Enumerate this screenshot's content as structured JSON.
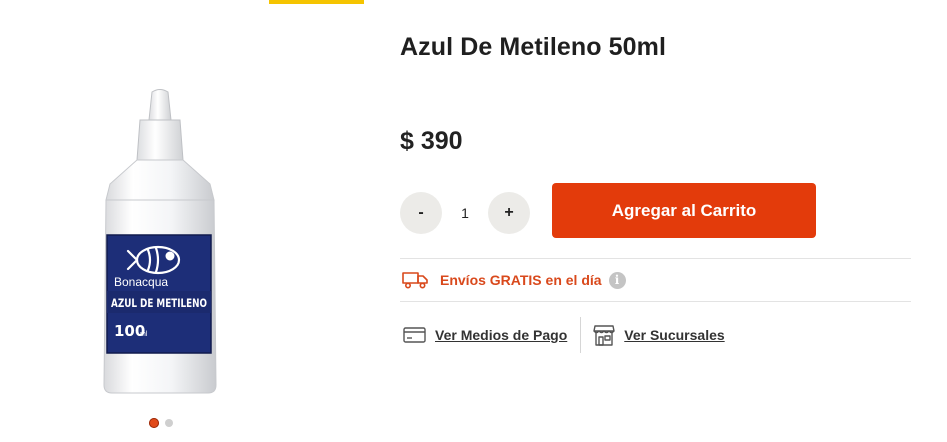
{
  "product": {
    "title": "Azul De Metileno 50ml",
    "price": "$ 390",
    "image_label": {
      "brand": "Bonacqua",
      "name": "AZUL DE METILENO",
      "volume": "100",
      "volume_unit": "ml"
    }
  },
  "gallery": {
    "slide_count": 2,
    "active_slide": 1
  },
  "quantity": {
    "minus_label": "-",
    "value": "1",
    "plus_label": "+"
  },
  "cart": {
    "add_label": "Agregar al Carrito"
  },
  "shipping": {
    "icon": "truck-icon",
    "text": "Envíos GRATIS en el día",
    "info_icon": "info-icon",
    "info_glyph": "i"
  },
  "links": {
    "payment": {
      "label": "Ver Medios de Pago",
      "icon": "credit-card-icon"
    },
    "stores": {
      "label": "Ver Sucursales",
      "icon": "store-icon"
    }
  },
  "colors": {
    "accent": "#e33b0b",
    "shipping_text": "#d9491c",
    "top_bar": "#f5c400",
    "qty_button_bg": "#ecebe8"
  }
}
